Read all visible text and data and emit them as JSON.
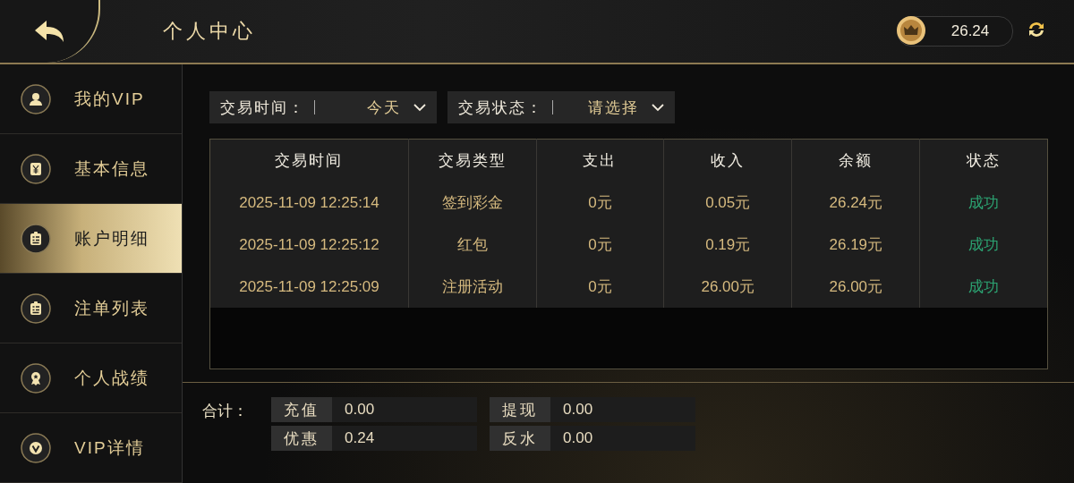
{
  "header": {
    "title": "个人中心",
    "balance": "26.24"
  },
  "sidebar": {
    "items": [
      {
        "label": "我的VIP",
        "kind": "person",
        "selected": false
      },
      {
        "label": "基本信息",
        "kind": "yuan",
        "selected": false
      },
      {
        "label": "账户明细",
        "kind": "list",
        "selected": true
      },
      {
        "label": "注单列表",
        "kind": "list",
        "selected": false
      },
      {
        "label": "个人战绩",
        "kind": "medal",
        "selected": false
      },
      {
        "label": "VIP详情",
        "kind": "vip",
        "selected": false
      }
    ]
  },
  "filters": [
    {
      "label": "交易时间：",
      "value": "今天"
    },
    {
      "label": "交易状态：",
      "value": "请选择"
    }
  ],
  "table": {
    "columns": [
      "交易时间",
      "交易类型",
      "支出",
      "收入",
      "余额",
      "状态"
    ],
    "rows": [
      [
        "2025-11-09 12:25:14",
        "签到彩金",
        "0元",
        "0.05元",
        "26.24元",
        "成功"
      ],
      [
        "2025-11-09 12:25:12",
        "红包",
        "0元",
        "0.19元",
        "26.19元",
        "成功"
      ],
      [
        "2025-11-09 12:25:09",
        "注册活动",
        "0元",
        "26.00元",
        "26.00元",
        "成功"
      ]
    ]
  },
  "totals": {
    "label": "合计：",
    "items": [
      {
        "label": "充值",
        "value": "0.00"
      },
      {
        "label": "提现",
        "value": "0.00"
      },
      {
        "label": "优惠",
        "value": "0.24"
      },
      {
        "label": "反水",
        "value": "0.00"
      }
    ]
  }
}
